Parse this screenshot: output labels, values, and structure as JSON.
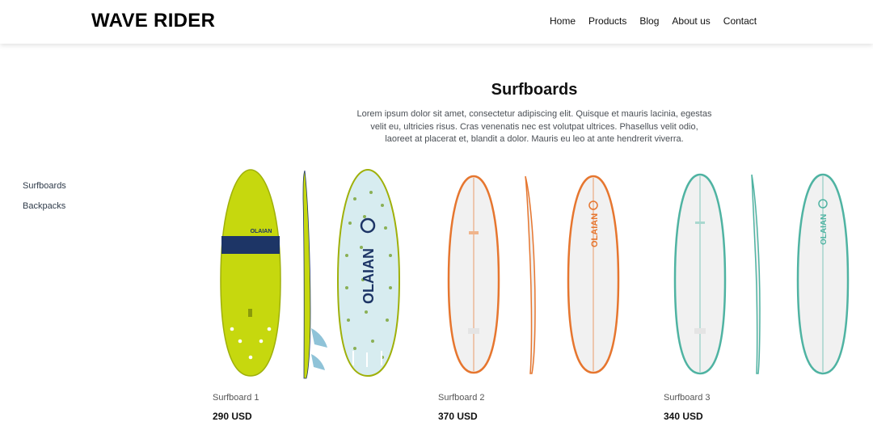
{
  "brand": {
    "name": "WAVE RIDER"
  },
  "nav": {
    "items": [
      {
        "label": "Home"
      },
      {
        "label": "Products"
      },
      {
        "label": "Blog"
      },
      {
        "label": "About us"
      },
      {
        "label": "Contact"
      }
    ]
  },
  "sidebar": {
    "items": [
      {
        "label": "Surfboards"
      },
      {
        "label": "Backpacks"
      }
    ]
  },
  "main": {
    "title": "Surfboards",
    "description": "Lorem ipsum dolor sit amet, consectetur adipiscing elit. Quisque et mauris lacinia, egestas velit eu, ultricies risus. Cras venenatis nec est volutpat ultrices. Phasellus velit odio, laoreet at placerat et, blandit a dolor. Mauris eu leo at ante hendrerit viverra."
  },
  "products": [
    {
      "name": "Surfboard 1",
      "price": "290 USD",
      "board_color": "#c6d80e",
      "accent": "#1d3566",
      "brand_text": "OLAIAN"
    },
    {
      "name": "Surfboard 2",
      "price": "370 USD",
      "board_color": "#f1f1f1",
      "accent": "#e6762f",
      "brand_text": "OLAIAN"
    },
    {
      "name": "Surfboard 3",
      "price": "340 USD",
      "board_color": "#f1f1f1",
      "accent": "#4fb3a2",
      "brand_text": "OLAIAN"
    }
  ]
}
